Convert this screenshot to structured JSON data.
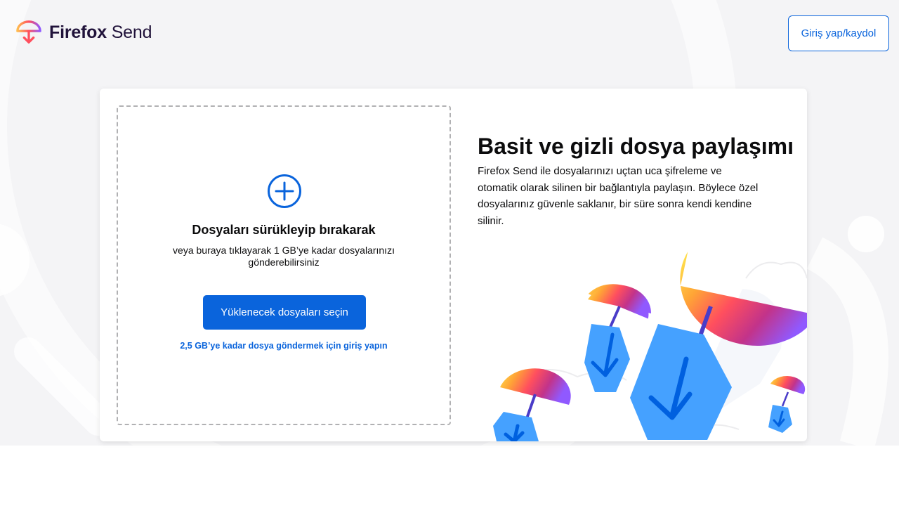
{
  "header": {
    "logo_bold": "Firefox",
    "logo_light": "Send",
    "signin_label": "Giriş yap/kaydol"
  },
  "upload": {
    "title": "Dosyaları sürükleyip bırakarak",
    "subtitle": "veya buraya tıklayarak 1 GB’ye kadar dosyalarınızı gönderebilirsiniz",
    "select_button": "Yüklenecek dosyaları seçin",
    "signin_link": "2,5 GB’ye kadar dosya göndermek için giriş yapın"
  },
  "intro": {
    "title": "Basit ve gizli dosya paylaşımı",
    "text": "Firefox Send ile dosyalarınızı uçtan uca şifreleme ve otomatik olarak silinen bir bağlantıyla paylaşın. Böylece özel dosyalarınız güvenle saklanır, bir süre sonra kendi kendine silinir."
  },
  "icons": {
    "logo": "firefox-send-logo-icon",
    "add": "plus-circle-icon"
  },
  "colors": {
    "accent": "#0a64dc",
    "background": "#f4f4f6",
    "text": "#0c0c0d"
  }
}
